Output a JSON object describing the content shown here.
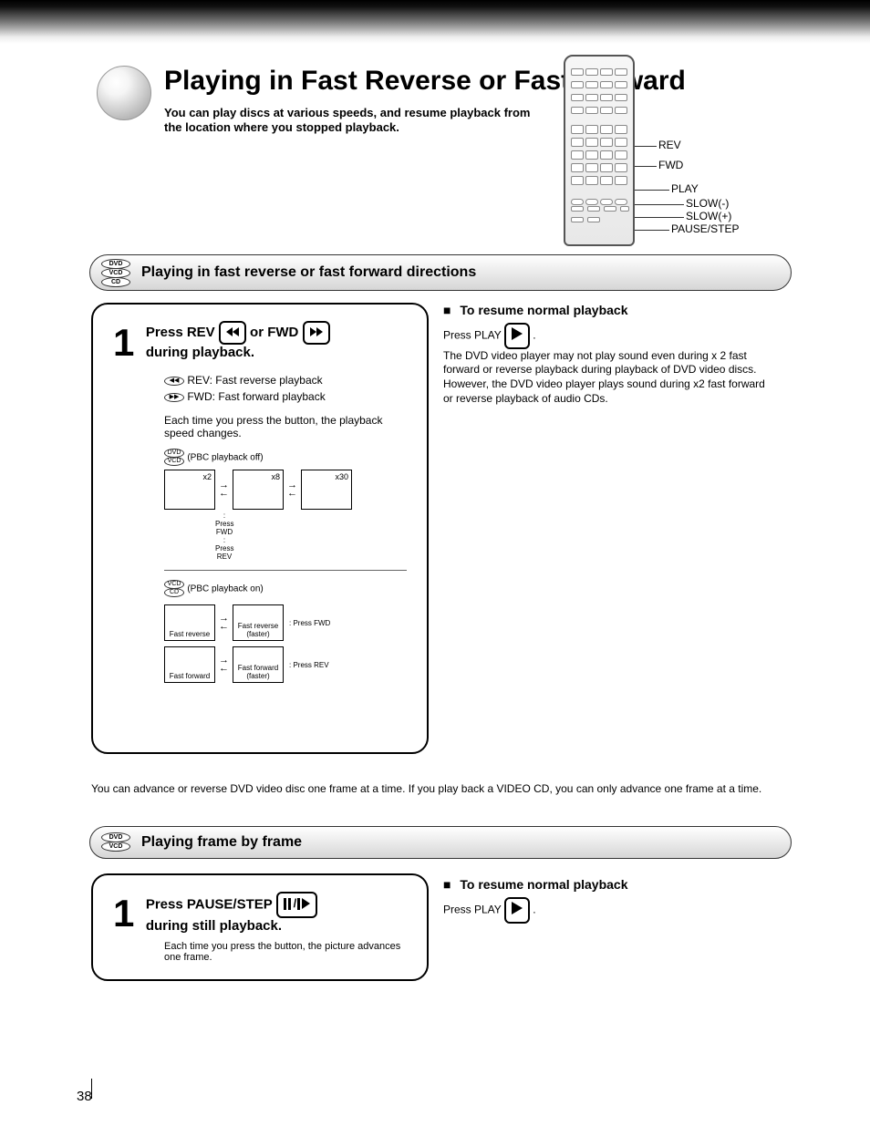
{
  "title": {
    "main": "Playing in Fast Reverse or Fast Forward",
    "sub": "You can play discs at various speeds, and resume playback from the location where you stopped playback."
  },
  "remote_labels": {
    "rev": "REV",
    "fwd": "FWD",
    "play": "PLAY",
    "slow_down": "SLOW(-)",
    "slow_up": "SLOW(+)",
    "pause_step": "PAUSE/STEP"
  },
  "section1": {
    "title": "Playing in fast reverse or fast forward directions",
    "discs": [
      "DVD",
      "VCD",
      "CD"
    ],
    "step_num": "1",
    "step_line1_prefix": "Press REV",
    "step_line1_mid": "or FWD",
    "step_line1_suffix": "during playback.",
    "rev_label": "REV: Fast reverse playback",
    "fwd_label": "FWD: Fast forward playback",
    "speed_intro": "Each time you press the button, the playback speed changes.",
    "dvd_vcd_discs": [
      "DVD",
      "VCD"
    ],
    "dvd_vcd_label": "(PBC playback off)",
    "speed_boxes": [
      {
        "x": "x2",
        "press_r": ": Press FWD",
        "press_l": ": Press REV"
      },
      {
        "x": "x8",
        "press_r": ": Press FWD",
        "press_l": ": Press REV"
      },
      {
        "x": "x30"
      }
    ],
    "cd_vcd_discs": [
      "VCD",
      "CD"
    ],
    "cd_vcd_label": "(PBC playback on)",
    "sub_boxes_top": [
      {
        "top_label": ": Press FWD",
        "tl": "Fast reverse",
        "tr": "Fast reverse (faster)"
      },
      {
        "bot_label": ": Press REV",
        "bl": "Fast forward",
        "br": "Fast forward (faster)"
      }
    ]
  },
  "side_note1": {
    "heading": "To resume normal playback",
    "body_prefix": "Press PLAY",
    "body": ".\nThe DVD video player may not play sound even during x 2 fast forward or reverse playback during playback of DVD video discs. However, the DVD video player plays sound during x2 fast forward or reverse playback of audio CDs."
  },
  "intro2_text": "You can advance or reverse DVD video disc one frame at a time.\nIf you play back a VIDEO CD, you can only advance one frame at a time.",
  "section2": {
    "title": "Playing frame by frame",
    "discs": [
      "DVD",
      "VCD"
    ],
    "step_num": "1",
    "step_line1": "Press PAUSE/STEP",
    "step_line2": "during still playback.",
    "note": "Each time you press the button, the picture advances one frame."
  },
  "side_note2": {
    "heading": "To resume normal playback",
    "body_prefix": "Press PLAY",
    "body": "."
  },
  "page_number": "38"
}
